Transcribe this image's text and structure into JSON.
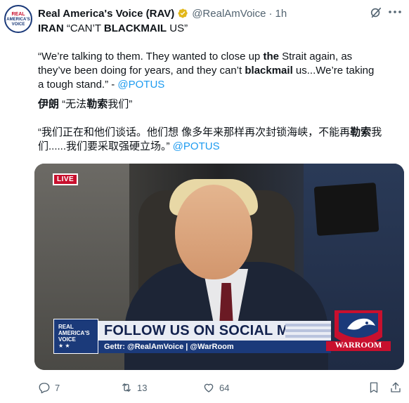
{
  "author": {
    "avatar_text": [
      "REAL",
      "AMERICA'S",
      "VOICE"
    ],
    "name": "Real America's Voice (RAV)",
    "handle": "@RealAmVoice",
    "separator": "·",
    "time": "1h"
  },
  "tweet": {
    "line1_a": "IRAN",
    "line1_b": " “CAN’T ",
    "line1_c": "BLACKMAIL",
    "line1_d": " US”",
    "quote_a": "“We’re talking to them. They wanted to close up ",
    "quote_b": "the",
    "quote_c": " Strait again, as they’ve been doing for years, and they can’t ",
    "quote_d": "blackmail",
    "quote_e": " us...We’re taking a tough stand.” - ",
    "mention_1": "@POTUS",
    "cn_title_a": "伊朗",
    "cn_title_b": " “无法",
    "cn_title_c": "勒索",
    "cn_title_d": "我们”",
    "cn_quote_a": "“我们正在和他们谈话。他们想  像多年来那样再次封锁海峡，不能再",
    "cn_quote_b": "勒索",
    "cn_quote_c": "我们......我们要采取强硬立场。” ",
    "mention_2": "@POTUS"
  },
  "media": {
    "live_label": "LIVE",
    "banner_logo": [
      "REAL",
      "AMERICA'S",
      "VOICE"
    ],
    "banner_stars": "★                    ★",
    "banner_title": "FOLLOW US ON SOCIAL MEDIA",
    "banner_subtitle": "Gettr: @RealAmVoice | @WarRoom",
    "warroom_label": "WARROOM"
  },
  "actions": {
    "replies": "7",
    "reposts": "13",
    "likes": "64"
  },
  "colors": {
    "accent": "#1d9bf0",
    "muted": "#536471",
    "verified_gold": "#e2b719",
    "brand_navy": "#1b3a7a",
    "brand_red": "#c8102e"
  }
}
